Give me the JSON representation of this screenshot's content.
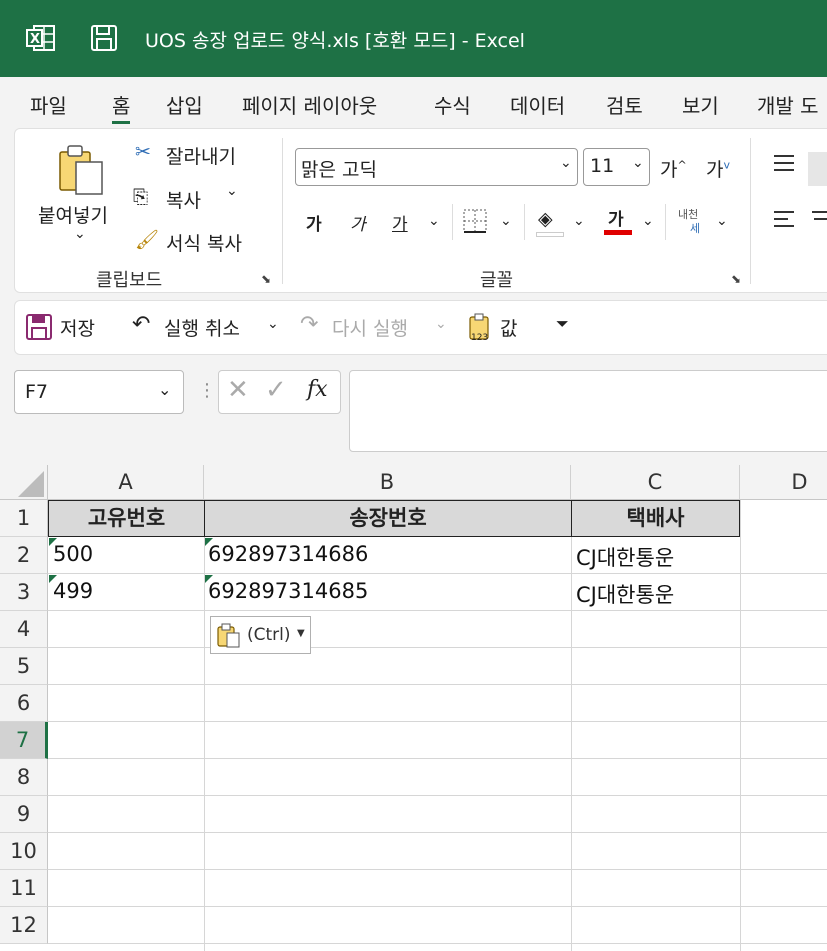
{
  "window": {
    "title": "UOS 송장 업로드 양식.xls  [호환 모드]  -  Excel"
  },
  "menu": [
    "파일",
    "홈",
    "삽입",
    "페이지 레이아웃",
    "수식",
    "데이터",
    "검토",
    "보기",
    "개발 도"
  ],
  "ribbon": {
    "paste": "붙여넣기",
    "cut": "잘라내기",
    "copy": "복사",
    "format_painter": "서식 복사",
    "clipboard_group": "클립보드",
    "font_name": "맑은 고딕",
    "font_size": "11",
    "bold": "가",
    "italic": "가",
    "underline": "가",
    "font_color_glyph": "가",
    "phonetic_top": "내천",
    "phonetic_bottom": "세",
    "grow_font": "가",
    "shrink_font": "가",
    "font_group": "글꼴"
  },
  "qat": {
    "save": "저장",
    "undo": "실행 취소",
    "redo": "다시 실행",
    "values": "값"
  },
  "formula_bar": {
    "name_box": "F7",
    "fx": "fx",
    "value": ""
  },
  "sheet": {
    "columns": [
      "A",
      "B",
      "C",
      "D"
    ],
    "rows": [
      "1",
      "2",
      "3",
      "4",
      "5",
      "6",
      "7",
      "8",
      "9",
      "10",
      "11",
      "12"
    ],
    "header": [
      "고유번호",
      "송장번호",
      "택배사"
    ],
    "data": [
      [
        "500",
        "692897314686",
        "CJ대한통운"
      ],
      [
        "499",
        "692897314685",
        "CJ대한통운"
      ]
    ],
    "paste_options": "(Ctrl)"
  },
  "colors": {
    "accent": "#1e7145",
    "font_color_bar": "#e00000"
  }
}
